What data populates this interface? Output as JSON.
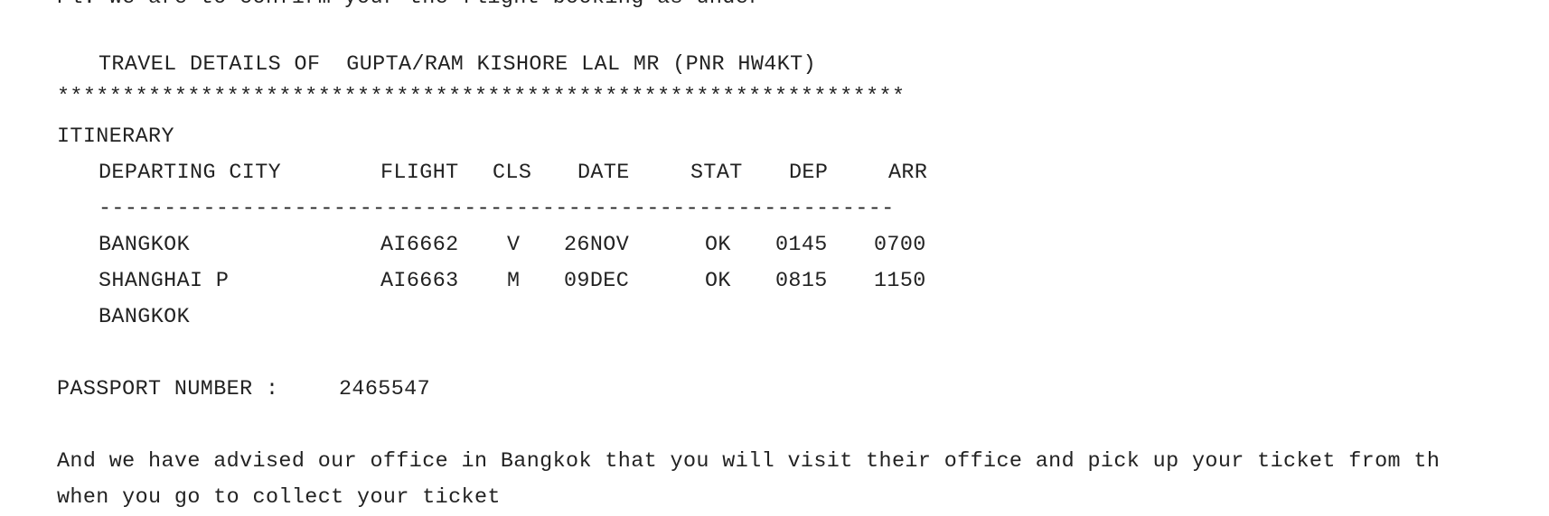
{
  "intro_partial": "Pl. We are to confirm your the flight booking as under",
  "heading": "TRAVEL DETAILS OF  GUPTA/RAM KISHORE LAL MR (PNR HW4KT)",
  "stars": "*****************************************************************",
  "itinerary_label": "ITINERARY",
  "columns": {
    "city": "DEPARTING CITY",
    "flight": "FLIGHT",
    "cls": "CLS",
    "date": "DATE",
    "stat": "STAT",
    "dep": "DEP",
    "arr": "ARR"
  },
  "divider": "-------------------------------------------------------------",
  "rows": [
    {
      "city": "BANGKOK",
      "flight": "AI6662",
      "cls": "V",
      "date": "26NOV",
      "stat": "OK",
      "dep": "0145",
      "arr": "0700"
    },
    {
      "city": "SHANGHAI P",
      "flight": "AI6663",
      "cls": "M",
      "date": "09DEC",
      "stat": "OK",
      "dep": "0815",
      "arr": "1150"
    },
    {
      "city": "BANGKOK",
      "flight": "",
      "cls": "",
      "date": "",
      "stat": "",
      "dep": "",
      "arr": ""
    }
  ],
  "passport": {
    "label": "PASSPORT NUMBER :",
    "value": "2465547"
  },
  "closing_line1": "And we have advised our office in Bangkok that you will visit their office and pick up your ticket from th",
  "closing_line2": "when you go to collect your ticket"
}
